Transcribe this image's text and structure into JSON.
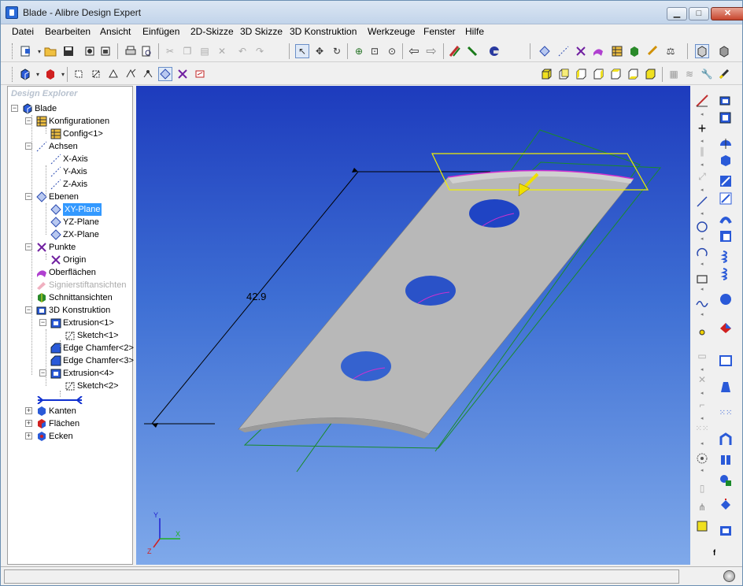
{
  "window": {
    "title": "Blade - Alibre Design Expert",
    "controls": [
      "minimize",
      "maximize",
      "close"
    ]
  },
  "menu": [
    "Datei",
    "Bearbeiten",
    "Ansicht",
    "Einfügen",
    "2D-Skizze",
    "3D Skizze",
    "3D Konstruktion",
    "Werkzeuge",
    "Fenster",
    "Hilfe"
  ],
  "explorer": {
    "title": "Design Explorer",
    "nodes": [
      {
        "label": "Blade",
        "level": 0,
        "exp": "−",
        "icon": "part-icon"
      },
      {
        "label": "Konfigurationen",
        "level": 1,
        "exp": "−",
        "icon": "table-icon"
      },
      {
        "label": "Config<1>",
        "level": 2,
        "exp": "",
        "icon": "table-icon"
      },
      {
        "label": "Achsen",
        "level": 1,
        "exp": "−",
        "icon": "axis-icon"
      },
      {
        "label": "X-Axis",
        "level": 2,
        "exp": "",
        "icon": "axis-icon"
      },
      {
        "label": "Y-Axis",
        "level": 2,
        "exp": "",
        "icon": "axis-icon"
      },
      {
        "label": "Z-Axis",
        "level": 2,
        "exp": "",
        "icon": "axis-icon"
      },
      {
        "label": "Ebenen",
        "level": 1,
        "exp": "−",
        "icon": "plane-icon"
      },
      {
        "label": "XY-Plane",
        "level": 2,
        "exp": "",
        "icon": "plane-icon",
        "selected": true
      },
      {
        "label": "YZ-Plane",
        "level": 2,
        "exp": "",
        "icon": "plane-icon"
      },
      {
        "label": "ZX-Plane",
        "level": 2,
        "exp": "",
        "icon": "plane-icon"
      },
      {
        "label": "Punkte",
        "level": 1,
        "exp": "−",
        "icon": "point-icon"
      },
      {
        "label": "Origin",
        "level": 2,
        "exp": "",
        "icon": "point-icon"
      },
      {
        "label": "Oberflächen",
        "level": 1,
        "exp": "",
        "icon": "surface-icon"
      },
      {
        "label": "Signierstiftansichten",
        "level": 1,
        "exp": "",
        "icon": "pen-icon",
        "greyed": true
      },
      {
        "label": "Schnittansichten",
        "level": 1,
        "exp": "",
        "icon": "section-icon"
      },
      {
        "label": "3D Konstruktion",
        "level": 1,
        "exp": "−",
        "icon": "feature-icon"
      },
      {
        "label": "Extrusion<1>",
        "level": 2,
        "exp": "−",
        "icon": "extrude-icon"
      },
      {
        "label": "Sketch<1>",
        "level": 3,
        "exp": "",
        "icon": "sketch-icon"
      },
      {
        "label": "Edge Chamfer<2>",
        "level": 2,
        "exp": "",
        "icon": "chamfer-icon"
      },
      {
        "label": "Edge Chamfer<3>",
        "level": 2,
        "exp": "",
        "icon": "chamfer-icon"
      },
      {
        "label": "Extrusion<4>",
        "level": 2,
        "exp": "−",
        "icon": "extrude-icon"
      },
      {
        "label": "Sketch<2>",
        "level": 3,
        "exp": "",
        "icon": "sketch-icon"
      },
      {
        "label": "",
        "level": 1,
        "exp": "",
        "icon": "rollback-bar-icon"
      },
      {
        "label": "Kanten",
        "level": 1,
        "exp": "+",
        "icon": "edge-icon"
      },
      {
        "label": "Flächen",
        "level": 1,
        "exp": "+",
        "icon": "face-icon"
      },
      {
        "label": "Ecken",
        "level": 1,
        "exp": "+",
        "icon": "vertex-icon"
      }
    ]
  },
  "viewport": {
    "dimension": "42.9",
    "background_top": "#1d3bbd",
    "background_bottom": "#7fa9ea"
  },
  "colors": {
    "selection": "#3399ff",
    "plane_green": "#1a8a2a",
    "sketch_magenta": "#d030d0",
    "highlight_yellow": "#f0f000"
  }
}
